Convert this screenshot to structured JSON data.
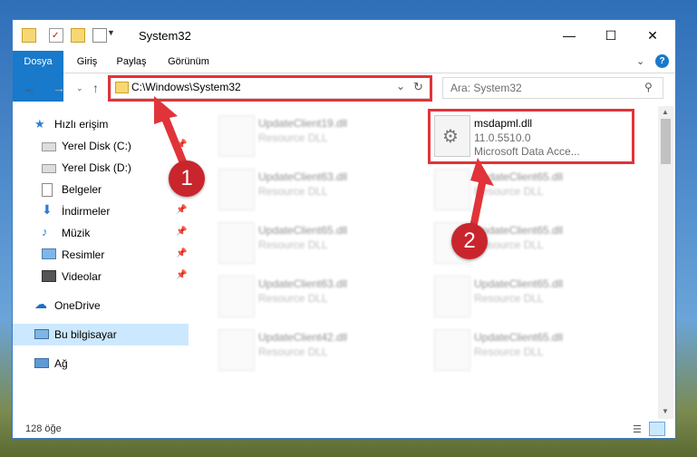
{
  "window": {
    "title": "System32"
  },
  "ribbon": {
    "tabs": [
      "Dosya",
      "Giriş",
      "Paylaş",
      "Görünüm"
    ]
  },
  "nav": {
    "address": "C:\\Windows\\System32",
    "search_placeholder": "Ara: System32"
  },
  "sidebar": {
    "items": [
      {
        "label": "Hızlı erişim",
        "icon": "star-icon"
      },
      {
        "label": "Yerel Disk (C:)",
        "icon": "drive-icon"
      },
      {
        "label": "Yerel Disk (D:)",
        "icon": "drive-icon"
      },
      {
        "label": "Belgeler",
        "icon": "documents-icon"
      },
      {
        "label": "İndirmeler",
        "icon": "download-icon"
      },
      {
        "label": "Müzik",
        "icon": "music-icon"
      },
      {
        "label": "Resimler",
        "icon": "pictures-icon"
      },
      {
        "label": "Videolar",
        "icon": "video-icon"
      },
      {
        "label": "OneDrive",
        "icon": "cloud-icon"
      },
      {
        "label": "Bu bilgisayar",
        "icon": "computer-icon"
      },
      {
        "label": "Ağ",
        "icon": "network-icon"
      }
    ]
  },
  "files": {
    "left": [
      {
        "name": "UpdateClient19.dll",
        "type": "Resource DLL"
      },
      {
        "name": "UpdateClient63.dll",
        "type": "Resource DLL"
      },
      {
        "name": "UpdateClient65.dll",
        "type": "Resource DLL"
      },
      {
        "name": "UpdateClient63.dll",
        "type": "Resource DLL"
      },
      {
        "name": "UpdateClient42.dll",
        "type": "Resource DLL"
      }
    ],
    "right": [
      {
        "name": "msdapml.dll",
        "version": "11.0.5510.0",
        "desc": "Microsoft Data Acce..."
      },
      {
        "name": "UpdateClient65.dll",
        "type": "Resource DLL"
      },
      {
        "name": "UpdateClient65.dll",
        "type": "Resource DLL"
      },
      {
        "name": "UpdateClient65.dll",
        "type": "Resource DLL"
      },
      {
        "name": "UpdateClient65.dll",
        "type": "Resource DLL"
      }
    ]
  },
  "status": {
    "count": "128 öğe"
  },
  "annotations": {
    "badge1": "1",
    "badge2": "2"
  },
  "colors": {
    "accent": "#1979ca",
    "highlight": "#e0343a",
    "selection": "#cce8ff"
  }
}
